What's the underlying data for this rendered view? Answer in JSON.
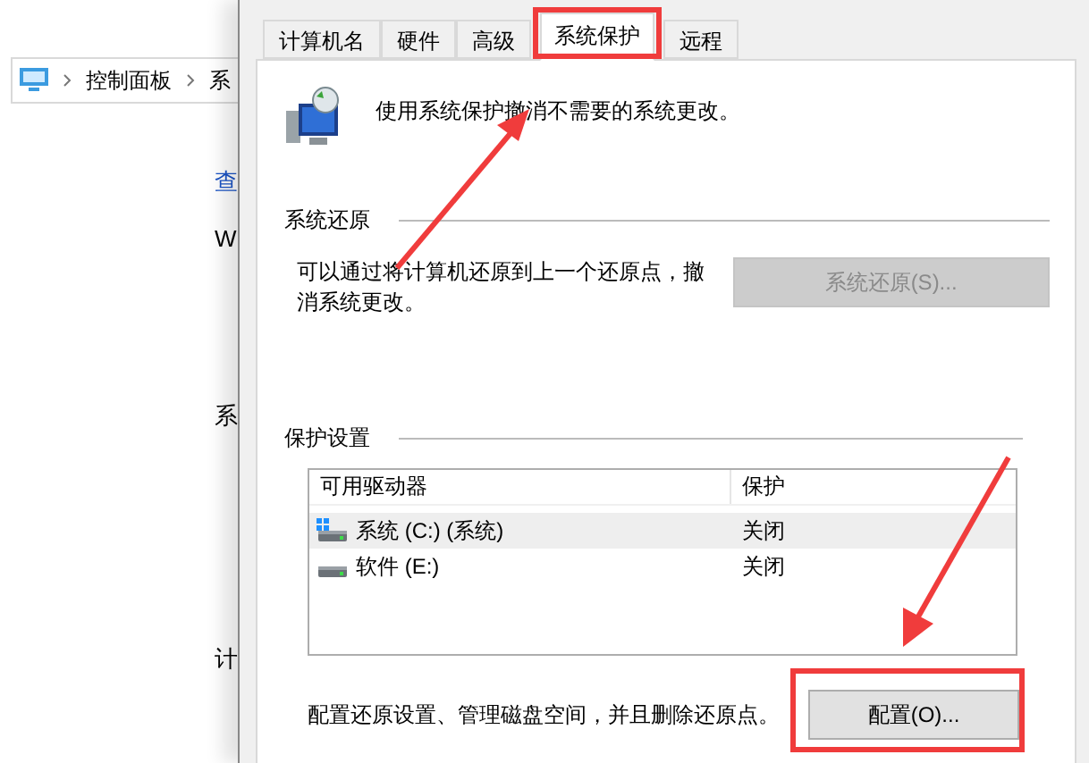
{
  "background_window": {
    "breadcrumb": [
      "控制面板",
      "系"
    ],
    "fragments": [
      {
        "text": "查",
        "kind": "link"
      },
      {
        "text": "W",
        "kind": "plain"
      },
      {
        "text": "系",
        "kind": "plain"
      },
      {
        "text": "计",
        "kind": "plain"
      }
    ]
  },
  "tabs": [
    {
      "label": "计算机名",
      "selected": false
    },
    {
      "label": "硬件",
      "selected": false
    },
    {
      "label": "高级",
      "selected": false
    },
    {
      "label": "系统保护",
      "selected": true
    },
    {
      "label": "远程",
      "selected": false
    }
  ],
  "description": "使用系统保护撤消不需要的系统更改。",
  "system_restore": {
    "heading": "系统还原",
    "text": "可以通过将计算机还原到上一个还原点，撤消系统更改。",
    "button": {
      "label": "系统还原(S)...",
      "disabled": true
    }
  },
  "protection": {
    "heading": "保护设置",
    "columns": [
      "可用驱动器",
      "保护"
    ],
    "rows": [
      {
        "drive": "系统 (C:) (系统)",
        "protection": "关闭",
        "kind": "system",
        "selected": true
      },
      {
        "drive": "软件 (E:)",
        "protection": "关闭",
        "kind": "plain",
        "selected": false
      }
    ],
    "configure_text": "配置还原设置、管理磁盘空间，并且删除还原点。",
    "configure_button": {
      "label": "配置(O)...",
      "disabled": false
    }
  }
}
